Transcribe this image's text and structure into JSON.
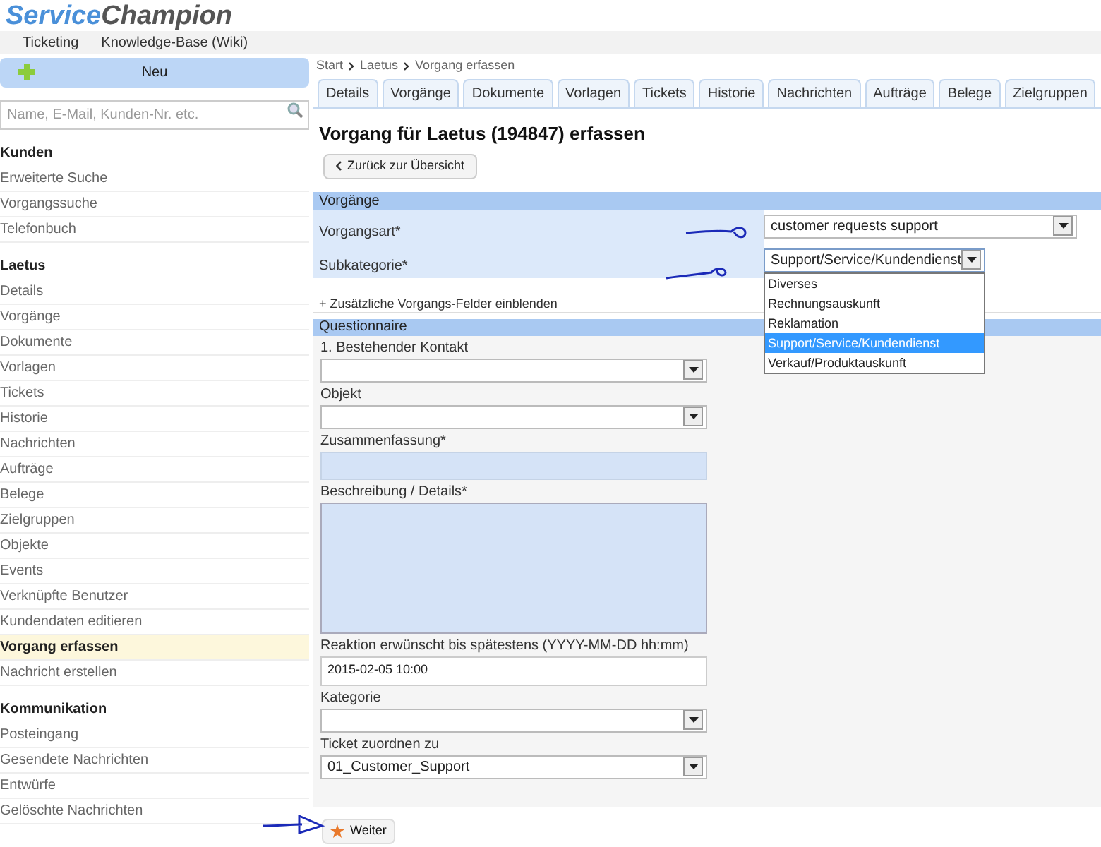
{
  "logo": {
    "part1": "Service",
    "part2": "Champion"
  },
  "top_menu": [
    "Ticketing",
    "Knowledge-Base (Wiki)"
  ],
  "new_button": "Neu",
  "search": {
    "placeholder": "Name, E-Mail, Kunden-Nr. etc."
  },
  "sidebar": {
    "sections": [
      {
        "title": "Kunden",
        "items": [
          {
            "label": "Erweiterte Suche",
            "selected": false
          },
          {
            "label": "Vorgangssuche",
            "selected": false
          },
          {
            "label": "Telefonbuch",
            "selected": false
          }
        ]
      },
      {
        "title": "Laetus",
        "items": [
          {
            "label": "Details",
            "selected": false
          },
          {
            "label": "Vorgänge",
            "selected": false
          },
          {
            "label": "Dokumente",
            "selected": false
          },
          {
            "label": "Vorlagen",
            "selected": false
          },
          {
            "label": "Tickets",
            "selected": false
          },
          {
            "label": "Historie",
            "selected": false
          },
          {
            "label": "Nachrichten",
            "selected": false
          },
          {
            "label": "Aufträge",
            "selected": false
          },
          {
            "label": "Belege",
            "selected": false
          },
          {
            "label": "Zielgruppen",
            "selected": false
          },
          {
            "label": "Objekte",
            "selected": false
          },
          {
            "label": "Events",
            "selected": false
          },
          {
            "label": "Verknüpfte Benutzer",
            "selected": false
          },
          {
            "label": "Kundendaten editieren",
            "selected": false
          },
          {
            "label": "Vorgang erfassen",
            "selected": true
          },
          {
            "label": "Nachricht erstellen",
            "selected": false
          }
        ]
      },
      {
        "title": "Kommunikation",
        "items": [
          {
            "label": "Posteingang",
            "selected": false
          },
          {
            "label": "Gesendete Nachrichten",
            "selected": false
          },
          {
            "label": "Entwürfe",
            "selected": false
          },
          {
            "label": "Gelöschte Nachrichten",
            "selected": false
          }
        ]
      }
    ]
  },
  "breadcrumb": [
    "Start",
    "Laetus",
    "Vorgang erfassen"
  ],
  "tabs": [
    {
      "label": "Details",
      "selected": false
    },
    {
      "label": "Vorgänge",
      "selected": false
    },
    {
      "label": "Dokumente",
      "selected": false
    },
    {
      "label": "Vorlagen",
      "selected": false
    },
    {
      "label": "Tickets",
      "selected": false
    },
    {
      "label": "Historie",
      "selected": false
    },
    {
      "label": "Nachrichten",
      "selected": false
    },
    {
      "label": "Aufträge",
      "selected": false
    },
    {
      "label": "Belege",
      "selected": false
    },
    {
      "label": "Zielgruppen",
      "selected": false
    }
  ],
  "page_title": "Vorgang für Laetus (194847) erfassen",
  "back_button": "Zurück zur Übersicht",
  "vorgaenge": {
    "title": "Vorgänge",
    "fields": [
      {
        "label": "Vorgangsart*",
        "value": "customer requests support",
        "expanded": false
      },
      {
        "label": "Subkategorie*",
        "value": "Support/Service/Kundendienst",
        "expanded": true,
        "options": [
          {
            "label": "Diverses",
            "selected": false
          },
          {
            "label": "Rechnungsauskunft",
            "selected": false
          },
          {
            "label": "Reklamation",
            "selected": false
          },
          {
            "label": "Support/Service/Kundendienst",
            "selected": true
          },
          {
            "label": "Verkauf/Produktauskunft",
            "selected": false
          }
        ]
      }
    ],
    "more_link": "+ Zusätzliche Vorgangs-Felder einblenden"
  },
  "questionnaire": {
    "title": "Questionnaire",
    "fields": [
      {
        "kind": "select",
        "label": "1. Bestehender Kontakt"
      },
      {
        "kind": "select",
        "label": "Objekt"
      },
      {
        "kind": "text",
        "label": "Zusammenfassung*"
      },
      {
        "kind": "textarea",
        "label": "Beschreibung / Details*"
      },
      {
        "kind": "input",
        "label": "Reaktion erwünscht bis spätestens (YYYY-MM-DD hh:mm)",
        "value": "2015-02-05 10:00"
      },
      {
        "kind": "select",
        "label": "Kategorie"
      },
      {
        "kind": "select",
        "label": "Ticket zuordnen zu",
        "value": "01_Customer_Support"
      }
    ]
  },
  "submit_button": "Weiter"
}
